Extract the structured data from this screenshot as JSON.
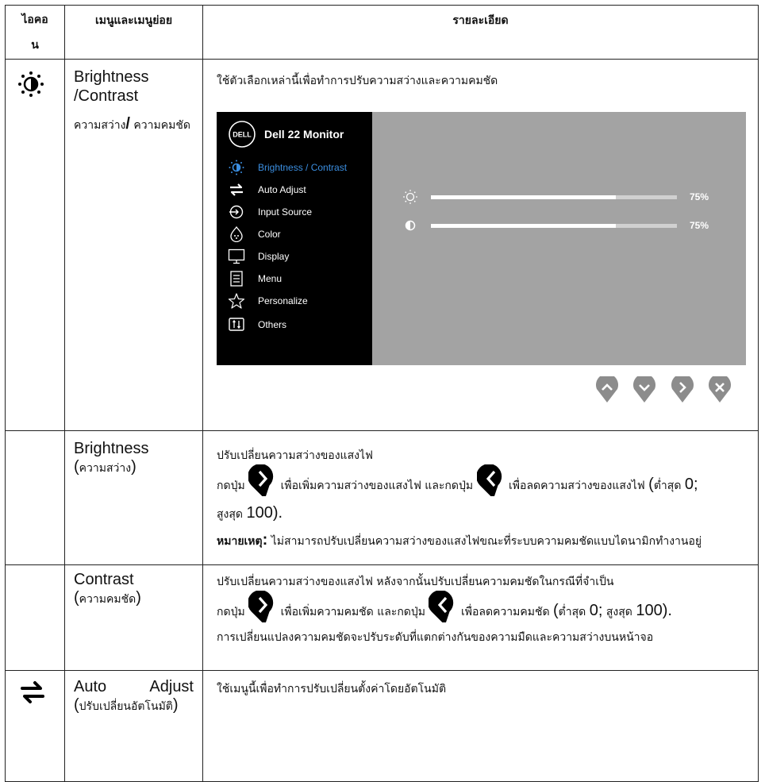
{
  "header": {
    "col_icon_line1": "ไอคอ",
    "col_icon_line2": "น",
    "col_menu": "เมนูและเมนูย่อย",
    "col_detail": "รายละเอียด"
  },
  "row_brightness_contrast": {
    "icon": "brightness-icon",
    "title_en_line1": "Brightness",
    "title_en_line2": "/Contrast",
    "title_th_a": "ความสว่าง",
    "title_th_slash": "/",
    "title_th_b": " ความคมชัด",
    "description": "ใช้ตัวเลือกเหล่านี้เพื่อทำการปรับความสว่างและความคมชัด",
    "osd": {
      "brand_logo": "DELL",
      "monitor_title": "Dell 22 Monitor",
      "menu_items": [
        {
          "label": "Brightness / Contrast",
          "icon": "brightness-icon",
          "active": true
        },
        {
          "label": "Auto Adjust",
          "icon": "auto-adjust-icon",
          "active": false
        },
        {
          "label": "Input Source",
          "icon": "input-source-icon",
          "active": false
        },
        {
          "label": "Color",
          "icon": "color-icon",
          "active": false
        },
        {
          "label": "Display",
          "icon": "display-icon",
          "active": false
        },
        {
          "label": "Menu",
          "icon": "menu-icon",
          "active": false
        },
        {
          "label": "Personalize",
          "icon": "star-icon",
          "active": false
        },
        {
          "label": "Others",
          "icon": "others-icon",
          "active": false
        }
      ],
      "brightness_value": 75,
      "brightness_label": "75%",
      "contrast_value": 75,
      "contrast_label": "75%",
      "colors": {
        "panel": "#000000",
        "content": "#a3a3a3",
        "active": "#3b8ee0",
        "bar_fill": "#ffffff"
      }
    },
    "nav_buttons": [
      "up-button",
      "down-button",
      "right-button",
      "close-button"
    ]
  },
  "row_brightness": {
    "title_en": "Brightness",
    "title_th": "ความสว่าง",
    "line1": "ปรับเปลี่ยนความสว่างของแสงไฟ",
    "press": "กดปุ่ม",
    "inc_text": "เพื่อเพิ่มความสว่างของแสงไฟ และกดปุ่ม",
    "dec_text": "เพื่อลดความสว่างของแสงไฟ",
    "min_label": "ต่ำสุด",
    "min_val": "0;",
    "max_label": "สูงสุด",
    "max_val": "100",
    "note_label": "หมายเหตุ",
    "note_text": "ไม่สามารถปรับเปลี่ยนความสว่างของแสงไฟขณะที่ระบบความคมชัดแบบไดนามิกทำงานอยู่"
  },
  "row_contrast": {
    "title_en": "Contrast",
    "title_th": "ความคมชัด",
    "line1": "ปรับเปลี่ยนความสว่างของแสงไฟ หลังจากนั้นปรับเปลี่ยนความคมชัดในกรณีที่จำเป็น",
    "press": "กดปุ่ม",
    "inc_text": "เพื่อเพิ่มความคมชัด และกดปุ่ม",
    "dec_text": "เพื่อลดความคมชัด",
    "min_label": "ต่ำสุด",
    "min_val": "0;",
    "max_label": "สูงสุด",
    "max_val": "100",
    "line3": "การเปลี่ยนแปลงความคมชัดจะปรับระดับที่แตกต่างกันของความมืดและความสว่างบนหน้าจอ"
  },
  "row_auto_adjust": {
    "icon": "auto-adjust-icon",
    "title_en_a": "Auto",
    "title_en_b": "Adjust",
    "title_th": "ปรับเปลี่ยนอัตโนมัติ",
    "description": "ใช้เมนูนี้เพื่อทำการปรับเปลี่ยนตั้งค่าโดยอัตโนมัติ"
  }
}
